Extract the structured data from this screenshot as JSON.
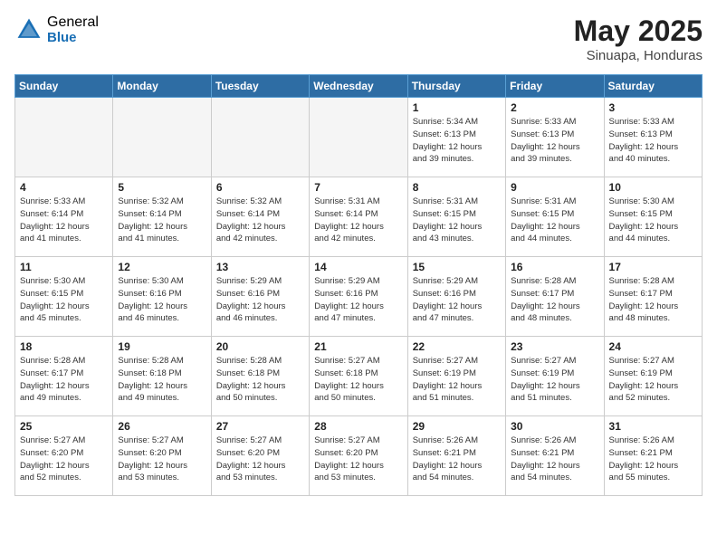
{
  "logo": {
    "general": "General",
    "blue": "Blue"
  },
  "title": {
    "month": "May 2025",
    "location": "Sinuapa, Honduras"
  },
  "days_header": [
    "Sunday",
    "Monday",
    "Tuesday",
    "Wednesday",
    "Thursday",
    "Friday",
    "Saturday"
  ],
  "weeks": [
    [
      {
        "day": "",
        "info": ""
      },
      {
        "day": "",
        "info": ""
      },
      {
        "day": "",
        "info": ""
      },
      {
        "day": "",
        "info": ""
      },
      {
        "day": "1",
        "info": "Sunrise: 5:34 AM\nSunset: 6:13 PM\nDaylight: 12 hours\nand 39 minutes."
      },
      {
        "day": "2",
        "info": "Sunrise: 5:33 AM\nSunset: 6:13 PM\nDaylight: 12 hours\nand 39 minutes."
      },
      {
        "day": "3",
        "info": "Sunrise: 5:33 AM\nSunset: 6:13 PM\nDaylight: 12 hours\nand 40 minutes."
      }
    ],
    [
      {
        "day": "4",
        "info": "Sunrise: 5:33 AM\nSunset: 6:14 PM\nDaylight: 12 hours\nand 41 minutes."
      },
      {
        "day": "5",
        "info": "Sunrise: 5:32 AM\nSunset: 6:14 PM\nDaylight: 12 hours\nand 41 minutes."
      },
      {
        "day": "6",
        "info": "Sunrise: 5:32 AM\nSunset: 6:14 PM\nDaylight: 12 hours\nand 42 minutes."
      },
      {
        "day": "7",
        "info": "Sunrise: 5:31 AM\nSunset: 6:14 PM\nDaylight: 12 hours\nand 42 minutes."
      },
      {
        "day": "8",
        "info": "Sunrise: 5:31 AM\nSunset: 6:15 PM\nDaylight: 12 hours\nand 43 minutes."
      },
      {
        "day": "9",
        "info": "Sunrise: 5:31 AM\nSunset: 6:15 PM\nDaylight: 12 hours\nand 44 minutes."
      },
      {
        "day": "10",
        "info": "Sunrise: 5:30 AM\nSunset: 6:15 PM\nDaylight: 12 hours\nand 44 minutes."
      }
    ],
    [
      {
        "day": "11",
        "info": "Sunrise: 5:30 AM\nSunset: 6:15 PM\nDaylight: 12 hours\nand 45 minutes."
      },
      {
        "day": "12",
        "info": "Sunrise: 5:30 AM\nSunset: 6:16 PM\nDaylight: 12 hours\nand 46 minutes."
      },
      {
        "day": "13",
        "info": "Sunrise: 5:29 AM\nSunset: 6:16 PM\nDaylight: 12 hours\nand 46 minutes."
      },
      {
        "day": "14",
        "info": "Sunrise: 5:29 AM\nSunset: 6:16 PM\nDaylight: 12 hours\nand 47 minutes."
      },
      {
        "day": "15",
        "info": "Sunrise: 5:29 AM\nSunset: 6:16 PM\nDaylight: 12 hours\nand 47 minutes."
      },
      {
        "day": "16",
        "info": "Sunrise: 5:28 AM\nSunset: 6:17 PM\nDaylight: 12 hours\nand 48 minutes."
      },
      {
        "day": "17",
        "info": "Sunrise: 5:28 AM\nSunset: 6:17 PM\nDaylight: 12 hours\nand 48 minutes."
      }
    ],
    [
      {
        "day": "18",
        "info": "Sunrise: 5:28 AM\nSunset: 6:17 PM\nDaylight: 12 hours\nand 49 minutes."
      },
      {
        "day": "19",
        "info": "Sunrise: 5:28 AM\nSunset: 6:18 PM\nDaylight: 12 hours\nand 49 minutes."
      },
      {
        "day": "20",
        "info": "Sunrise: 5:28 AM\nSunset: 6:18 PM\nDaylight: 12 hours\nand 50 minutes."
      },
      {
        "day": "21",
        "info": "Sunrise: 5:27 AM\nSunset: 6:18 PM\nDaylight: 12 hours\nand 50 minutes."
      },
      {
        "day": "22",
        "info": "Sunrise: 5:27 AM\nSunset: 6:19 PM\nDaylight: 12 hours\nand 51 minutes."
      },
      {
        "day": "23",
        "info": "Sunrise: 5:27 AM\nSunset: 6:19 PM\nDaylight: 12 hours\nand 51 minutes."
      },
      {
        "day": "24",
        "info": "Sunrise: 5:27 AM\nSunset: 6:19 PM\nDaylight: 12 hours\nand 52 minutes."
      }
    ],
    [
      {
        "day": "25",
        "info": "Sunrise: 5:27 AM\nSunset: 6:20 PM\nDaylight: 12 hours\nand 52 minutes."
      },
      {
        "day": "26",
        "info": "Sunrise: 5:27 AM\nSunset: 6:20 PM\nDaylight: 12 hours\nand 53 minutes."
      },
      {
        "day": "27",
        "info": "Sunrise: 5:27 AM\nSunset: 6:20 PM\nDaylight: 12 hours\nand 53 minutes."
      },
      {
        "day": "28",
        "info": "Sunrise: 5:27 AM\nSunset: 6:20 PM\nDaylight: 12 hours\nand 53 minutes."
      },
      {
        "day": "29",
        "info": "Sunrise: 5:26 AM\nSunset: 6:21 PM\nDaylight: 12 hours\nand 54 minutes."
      },
      {
        "day": "30",
        "info": "Sunrise: 5:26 AM\nSunset: 6:21 PM\nDaylight: 12 hours\nand 54 minutes."
      },
      {
        "day": "31",
        "info": "Sunrise: 5:26 AM\nSunset: 6:21 PM\nDaylight: 12 hours\nand 55 minutes."
      }
    ]
  ]
}
